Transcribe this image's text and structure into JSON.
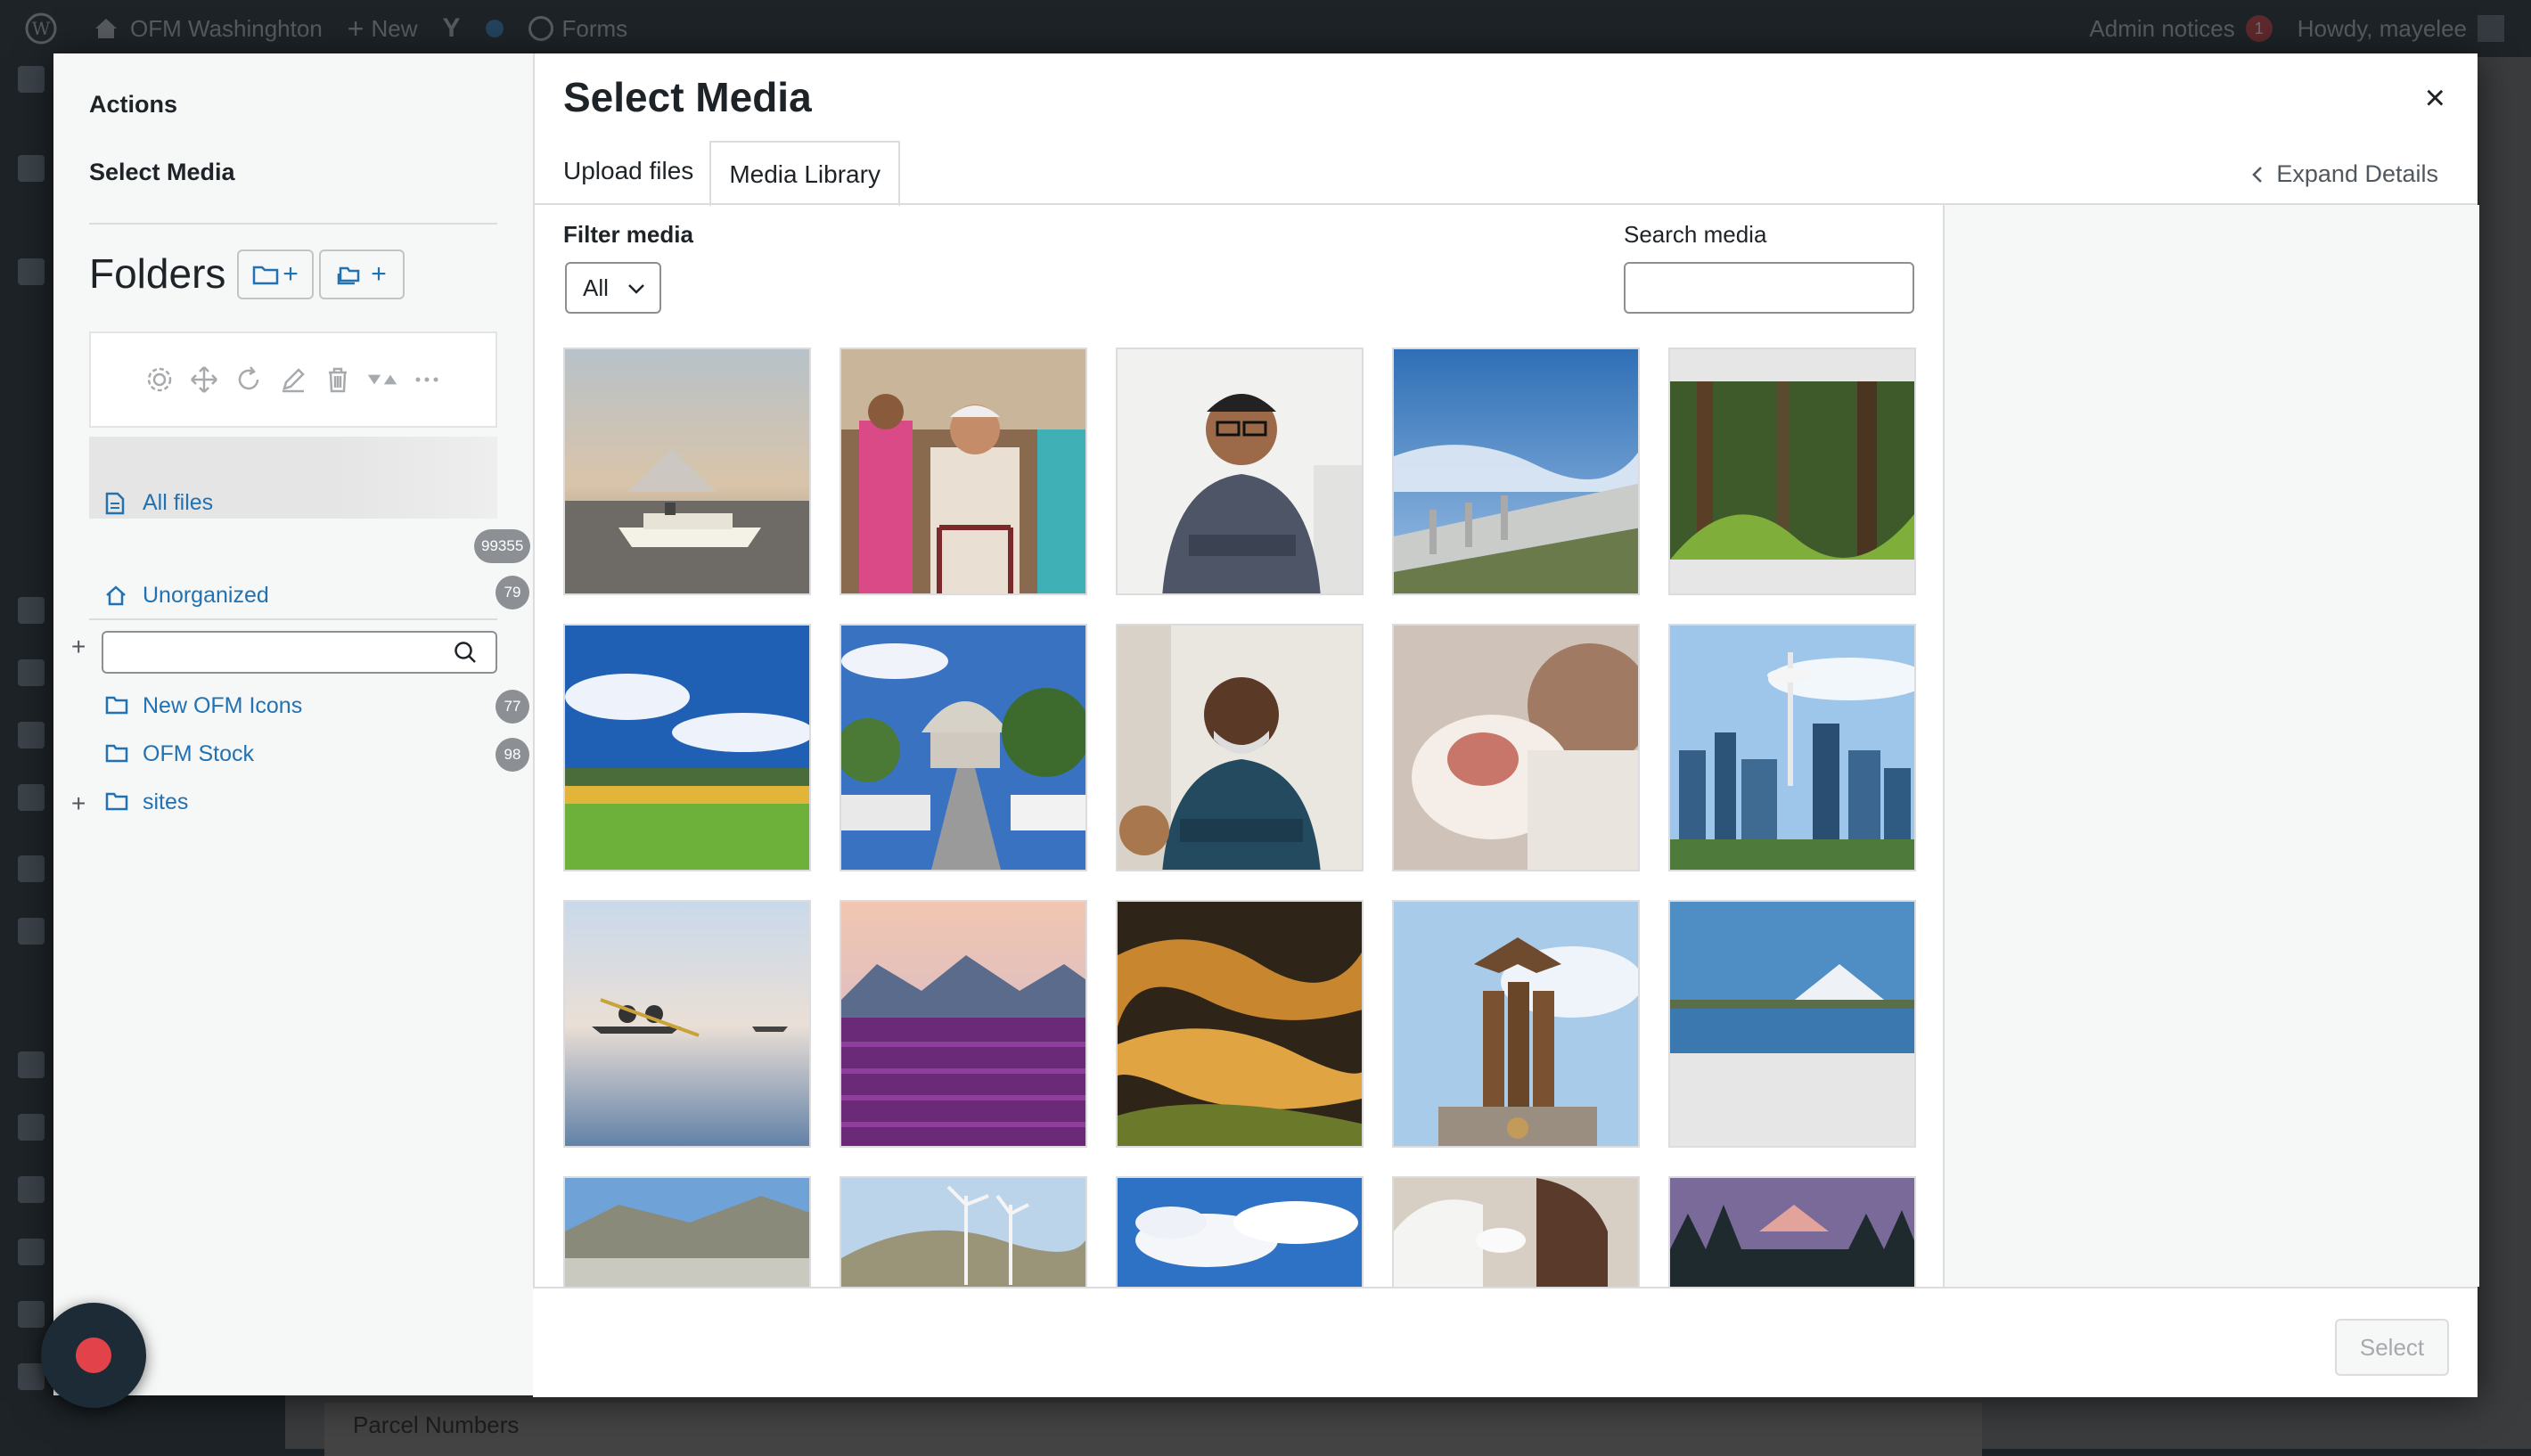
{
  "admin_bar": {
    "site_name": "OFM Washinghton",
    "new_label": "New",
    "forms_label": "Forms",
    "notices_label": "Admin notices",
    "notices_count": "1",
    "greeting": "Howdy, mayelee"
  },
  "background": {
    "strip_text": "Parcel Numbers"
  },
  "sidebar": {
    "actions_heading": "Actions",
    "select_media_heading": "Select Media",
    "folders_title": "Folders",
    "new_folder_label": "+",
    "new_cat_label": "+",
    "tree": {
      "all_files": {
        "label": "All files",
        "count": "99355"
      },
      "unorganized": {
        "label": "Unorganized",
        "count": "79"
      },
      "folders": [
        {
          "label": "New OFM Icons",
          "count": "77"
        },
        {
          "label": "OFM Stock",
          "count": "98"
        },
        {
          "label": "sites",
          "count": ""
        }
      ]
    },
    "search_placeholder": ""
  },
  "modal": {
    "title": "Select Media",
    "close_label": "×",
    "tabs": [
      {
        "label": "Upload files",
        "active": false
      },
      {
        "label": "Media Library",
        "active": true
      }
    ],
    "expand_details": "Expand Details",
    "filter_label": "Filter media",
    "filter_value": "All",
    "search_label": "Search media",
    "search_value": "",
    "select_button": "Select"
  },
  "media_items": [
    {
      "name": "ferry-mountain"
    },
    {
      "name": "senior-walker"
    },
    {
      "name": "smiling-man-glasses"
    },
    {
      "name": "dam-sky"
    },
    {
      "name": "forest"
    },
    {
      "name": "vineyard-field"
    },
    {
      "name": "capitol-street"
    },
    {
      "name": "bearded-man"
    },
    {
      "name": "newborn-baby"
    },
    {
      "name": "seattle-skyline"
    },
    {
      "name": "kayakers"
    },
    {
      "name": "tulip-field"
    },
    {
      "name": "palouse-hills"
    },
    {
      "name": "bronze-statue"
    },
    {
      "name": "rainier-waterfront"
    },
    {
      "name": "dam-hills"
    },
    {
      "name": "wind-turbines"
    },
    {
      "name": "clouds"
    },
    {
      "name": "coffee-meeting"
    },
    {
      "name": "mountain-sunset"
    }
  ]
}
